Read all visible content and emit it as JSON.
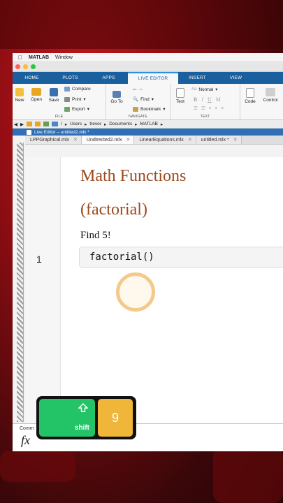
{
  "menubar": {
    "app": "MATLAB",
    "menu": "Window"
  },
  "ribbon_tabs": [
    "HOME",
    "PLOTS",
    "APPS",
    "LIVE EDITOR",
    "INSERT",
    "VIEW"
  ],
  "ribbon": {
    "new": "New",
    "open": "Open",
    "save": "Save",
    "compare": "Compare",
    "print": "Print",
    "export": "Export",
    "file_group": "FILE",
    "goto": "Go To",
    "find": "Find",
    "bookmark": "Bookmark",
    "navigate_group": "NAVIGATE",
    "text": "Text",
    "style": "Normal",
    "format_buttons": [
      "B",
      "I",
      "U",
      "M"
    ],
    "text_group": "TEXT",
    "code": "Code",
    "control": "Control"
  },
  "address": [
    "/",
    "Users",
    "trevor",
    "Documents",
    "MATLAB"
  ],
  "live_editor_title": "Live Editor – untitled2.mlx *",
  "file_tabs": [
    "LPPGraphical.mlx",
    "Undirected2.mlx",
    "LinearEquations.mlx",
    "untitled.mlx *"
  ],
  "doc": {
    "heading1": "Math Functions",
    "heading2": "(factorial)",
    "text": "Find  5!",
    "line_number": "1",
    "code": "factorial()"
  },
  "command_window": {
    "label": "Comm",
    "prompt": "fx"
  },
  "keys": {
    "shift": "shift",
    "nine": "9"
  },
  "colors": {
    "tab_bar": "#1a5f9e",
    "heading": "#9a4a1f",
    "shift_key": "#22c467",
    "nine_key": "#f0b63a"
  }
}
